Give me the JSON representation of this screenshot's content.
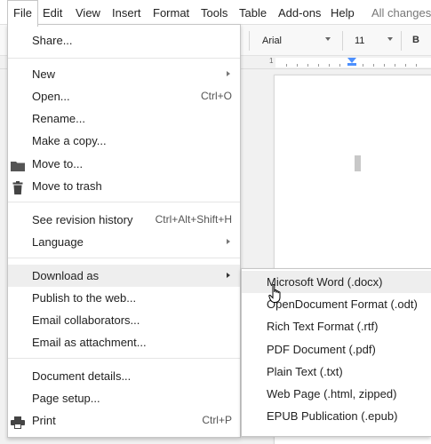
{
  "menubar": {
    "items": [
      {
        "label": "File"
      },
      {
        "label": "Edit"
      },
      {
        "label": "View"
      },
      {
        "label": "Insert"
      },
      {
        "label": "Format"
      },
      {
        "label": "Tools"
      },
      {
        "label": "Table"
      },
      {
        "label": "Add-ons"
      },
      {
        "label": "Help"
      }
    ],
    "status": "All changes"
  },
  "toolbar": {
    "font": "Arial",
    "size": "11",
    "bold": "B"
  },
  "ruler": {
    "number": "1"
  },
  "file_menu": {
    "items": [
      {
        "label": "Share..."
      },
      {
        "label": "New"
      },
      {
        "label": "Open...",
        "shortcut": "Ctrl+O"
      },
      {
        "label": "Rename..."
      },
      {
        "label": "Make a copy..."
      },
      {
        "label": "Move to...",
        "icon": "folder-icon"
      },
      {
        "label": "Move to trash",
        "icon": "trash-icon"
      },
      {
        "label": "See revision history",
        "shortcut": "Ctrl+Alt+Shift+H"
      },
      {
        "label": "Language"
      },
      {
        "label": "Download as"
      },
      {
        "label": "Publish to the web..."
      },
      {
        "label": "Email collaborators..."
      },
      {
        "label": "Email as attachment..."
      },
      {
        "label": "Document details..."
      },
      {
        "label": "Page setup..."
      },
      {
        "label": "Print",
        "shortcut": "Ctrl+P",
        "icon": "printer-icon"
      }
    ]
  },
  "download_submenu": {
    "items": [
      {
        "label": "Microsoft Word (.docx)"
      },
      {
        "label": "OpenDocument Format (.odt)"
      },
      {
        "label": "Rich Text Format (.rtf)"
      },
      {
        "label": "PDF Document (.pdf)"
      },
      {
        "label": "Plain Text (.txt)"
      },
      {
        "label": "Web Page (.html, zipped)"
      },
      {
        "label": "EPUB Publication (.epub)"
      }
    ]
  },
  "colors": {
    "highlight": "#eeeeee",
    "ruler_marker": "#4d90fe"
  }
}
